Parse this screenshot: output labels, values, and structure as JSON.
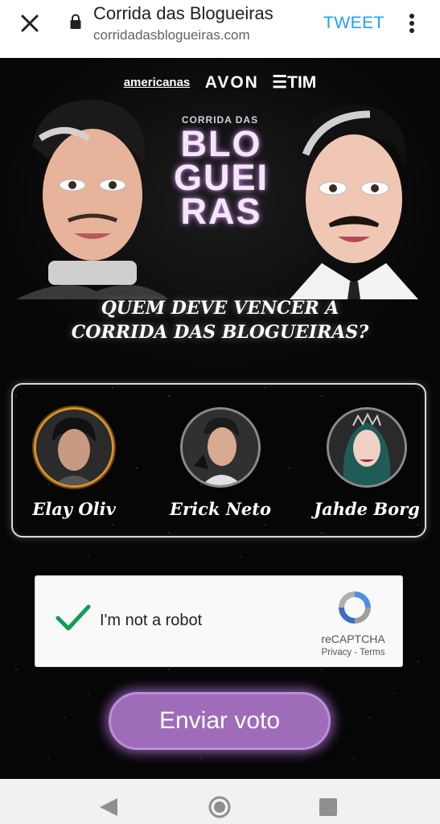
{
  "browser": {
    "title": "Corrida das Blogueiras",
    "url": "corridadasblogueiras.com",
    "tweet_label": "TWEET"
  },
  "hero": {
    "sponsors": [
      "americanas",
      "AVON",
      "TIM"
    ],
    "show_kicker": "CORRIDA DAS",
    "show_logo_lines": [
      "BLO",
      "GUEI",
      "RAS"
    ],
    "question_line1": "QUEM DEVE VENCER A",
    "question_line2": "CORRIDA DAS BLOGUEIRAS?"
  },
  "candidates": [
    {
      "name": "Elay Oliv",
      "selected": true
    },
    {
      "name": "Erick Neto",
      "selected": false
    },
    {
      "name": "Jahde Borg",
      "selected": false
    }
  ],
  "captcha": {
    "label": "I'm not a robot",
    "brand": "reCAPTCHA",
    "privacy": "Privacy",
    "separator": " - ",
    "terms": "Terms",
    "checked": true
  },
  "vote_button": {
    "label": "Enviar voto"
  },
  "colors": {
    "accent_purple": "#9e6cb8",
    "selected_ring": "#d4932b",
    "tweet_blue": "#1da1f2",
    "check_green": "#0f9d58"
  }
}
